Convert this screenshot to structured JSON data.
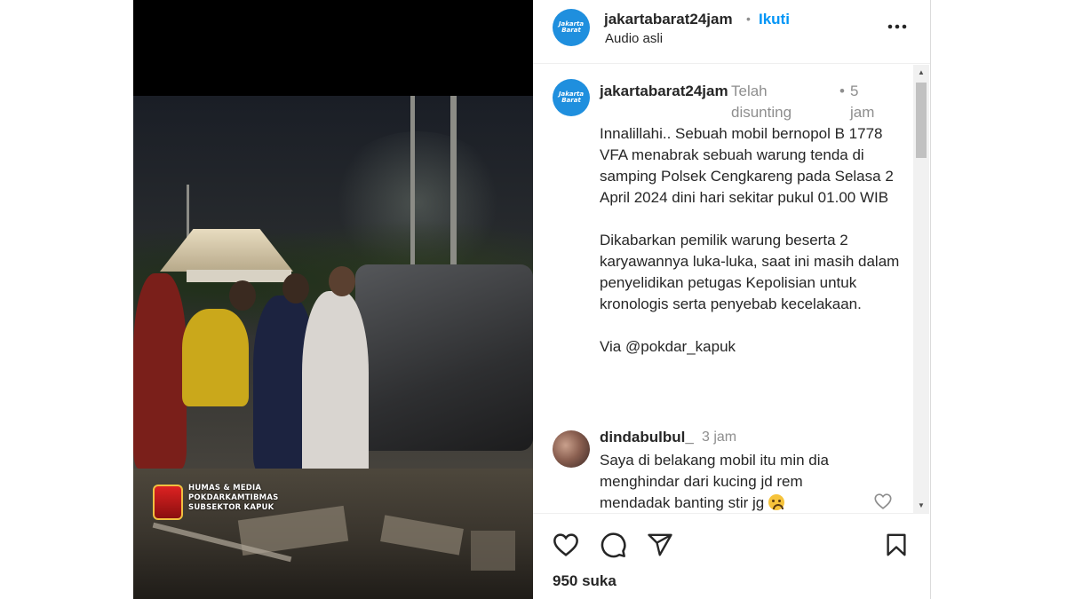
{
  "video": {
    "watermark_lines": [
      "HUMAS & MEDIA",
      "POKDARKAMTIBMAS",
      "SUBSEKTOR KAPUK"
    ]
  },
  "header": {
    "avatar_text": "Jakarta Barat",
    "username": "jakartabarat24jam",
    "dot": "•",
    "follow_label": "Ikuti",
    "audio_label": "Audio asli",
    "more_label": "•••"
  },
  "caption": {
    "avatar_text": "Jakarta Barat",
    "username": "jakartabarat24jam",
    "edited_label": "Telah disunting",
    "dot": "•",
    "time": "5 jam",
    "text": "Innalillahi.. Sebuah mobil bernopol B 1778 VFA menabrak sebuah warung tenda di samping Polsek Cengkareng pada Selasa 2 April 2024 dini hari sekitar pukul 01.00 WIB\n\nDikabarkan pemilik warung beserta 2 karyawannya luka-luka, saat ini masih dalam penyelidikan petugas Kepolisian untuk kronologis serta penyebab kecelakaan.\n\nVia @pokdar_kapuk"
  },
  "comment": {
    "username": "dindabulbul_",
    "time": "3 jam",
    "text": "Saya di belakang mobil itu min dia menghindar dari kucing jd rem mendadak banting stir jg"
  },
  "actions": {
    "likes_text": "950 suka"
  },
  "icons": [
    "heart-icon",
    "comment-icon",
    "share-icon",
    "bookmark-icon",
    "more-icon"
  ]
}
